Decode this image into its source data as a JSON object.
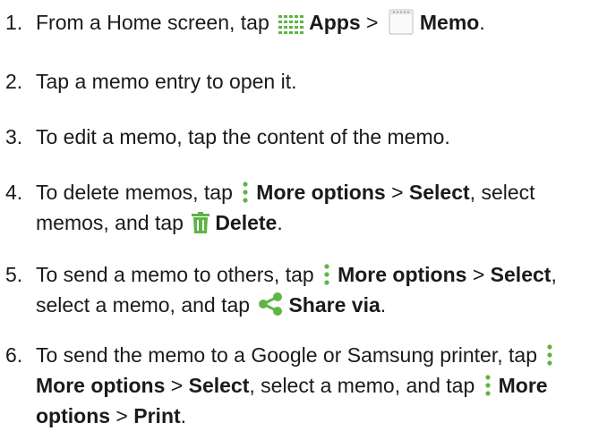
{
  "colors": {
    "icon_green": "#3fa33f",
    "icon_accent": "#5fb446",
    "text": "#1a1a1a"
  },
  "steps": [
    {
      "num": "1.",
      "a": "From a Home screen, tap ",
      "apps_icon": "apps-grid-icon",
      "apps": "Apps",
      "sep": " > ",
      "memo_icon": "memo-notepad-icon",
      "memo": "Memo",
      "end": "."
    },
    {
      "num": "2.",
      "text": "Tap a memo entry to open it."
    },
    {
      "num": "3.",
      "text": "To edit a memo, tap the content of the memo."
    },
    {
      "num": "4.",
      "a": "To delete memos, tap ",
      "more_icon": "more-options-icon",
      "more": "More options",
      "sep": " > ",
      "select": "Select",
      "b": ", select memos, and tap ",
      "delete_icon": "trash-icon",
      "delete": "Delete",
      "end": "."
    },
    {
      "num": "5.",
      "a": "To send a memo to others, tap ",
      "more_icon": "more-options-icon",
      "more": "More options",
      "sep": " > ",
      "select": "Select",
      "b": ", select a memo, and tap ",
      "share_icon": "share-icon",
      "share": "Share via",
      "end": "."
    },
    {
      "num": "6.",
      "a": "To send the memo to a Google or Samsung printer, tap ",
      "more_icon": "more-options-icon",
      "more": "More options",
      "sep": " > ",
      "select": "Select",
      "b": ", select a memo, and tap ",
      "more2": "More options",
      "sep2": " > ",
      "print": "Print",
      "end": "."
    }
  ]
}
